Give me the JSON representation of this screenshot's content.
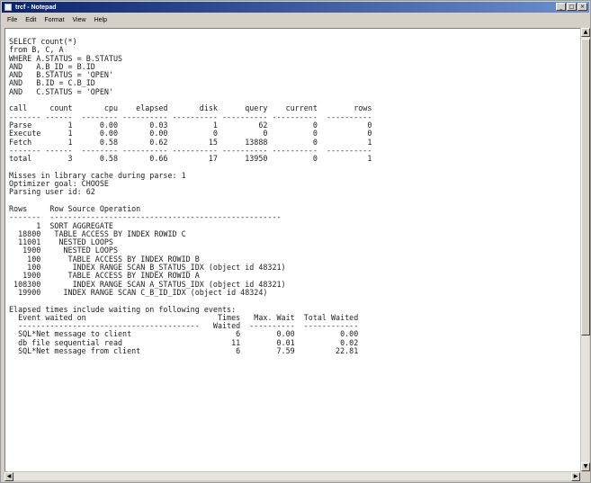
{
  "window": {
    "title": "trcf - Notepad",
    "minimize_glyph": "_",
    "maximize_glyph": "□",
    "close_glyph": "×"
  },
  "menu": [
    "File",
    "Edit",
    "Format",
    "View",
    "Help"
  ],
  "trace_text": "SELECT count(*)\nfrom B, C, A\nWHERE A.STATUS = B.STATUS\nAND   A.B_ID = B.ID\nAND   B.STATUS = 'OPEN'\nAND   B.ID = C.B_ID\nAND   C.STATUS = 'OPEN'\n\ncall     count       cpu    elapsed       disk      query    current        rows\n------- ------  -------- ---------- ---------- ---------- ----------  ----------\nParse        1      0.00       0.03          1         62          0           0\nExecute      1      0.00       0.00          0          0          0           0\nFetch        1      0.58       0.62         15      13888          0           1\n------- ------  -------- ---------- ---------- ---------- ----------  ----------\ntotal        3      0.58       0.66         17      13950          0           1\n\nMisses in library cache during parse: 1\nOptimizer goal: CHOOSE\nParsing user id: 62\n\nRows     Row Source Operation\n-------  ---------------------------------------------------\n      1  SORT AGGREGATE\n  18800   TABLE ACCESS BY INDEX ROWID C\n  11001    NESTED LOOPS\n   1900     NESTED LOOPS\n    100      TABLE ACCESS BY INDEX ROWID B\n    100       INDEX RANGE SCAN B_STATUS_IDX (object id 48321)\n   1900      TABLE ACCESS BY INDEX ROWID A\n 108300       INDEX RANGE SCAN A_STATUS_IDX (object id 48321)\n  19900     INDEX RANGE SCAN C_B_ID_IDX (object id 48324)\n\nElapsed times include waiting on following events:\n  Event waited on                             Times   Max. Wait  Total Waited\n  ----------------------------------------   Waited  ----------  ------------\n  SQL*Net message to client                       6        0.00          0.00\n  db file sequential read                        11        0.01          0.02\n  SQL*Net message from client                     6        7.59         22.81"
}
